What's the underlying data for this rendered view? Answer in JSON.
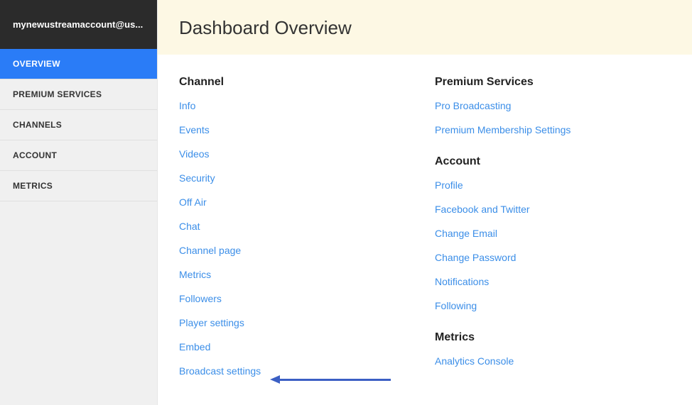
{
  "sidebar": {
    "account_label": "mynewustreamaccount@us...",
    "items": [
      {
        "label": "OVERVIEW",
        "active": true
      },
      {
        "label": "PREMIUM SERVICES",
        "active": false
      },
      {
        "label": "CHANNELS",
        "active": false
      },
      {
        "label": "ACCOUNT",
        "active": false
      },
      {
        "label": "METRICS",
        "active": false
      }
    ]
  },
  "header": {
    "title": "Dashboard Overview"
  },
  "sections": {
    "channel": {
      "heading": "Channel",
      "links": [
        "Info",
        "Events",
        "Videos",
        "Security",
        "Off Air",
        "Chat",
        "Channel page",
        "Metrics",
        "Followers",
        "Player settings",
        "Embed",
        "Broadcast settings"
      ]
    },
    "premium": {
      "heading": "Premium Services",
      "links": [
        "Pro Broadcasting",
        "Premium Membership Settings"
      ]
    },
    "account": {
      "heading": "Account",
      "links": [
        "Profile",
        "Facebook and Twitter",
        "Change Email",
        "Change Password",
        "Notifications",
        "Following"
      ]
    },
    "metrics": {
      "heading": "Metrics",
      "links": [
        "Analytics Console"
      ]
    }
  }
}
